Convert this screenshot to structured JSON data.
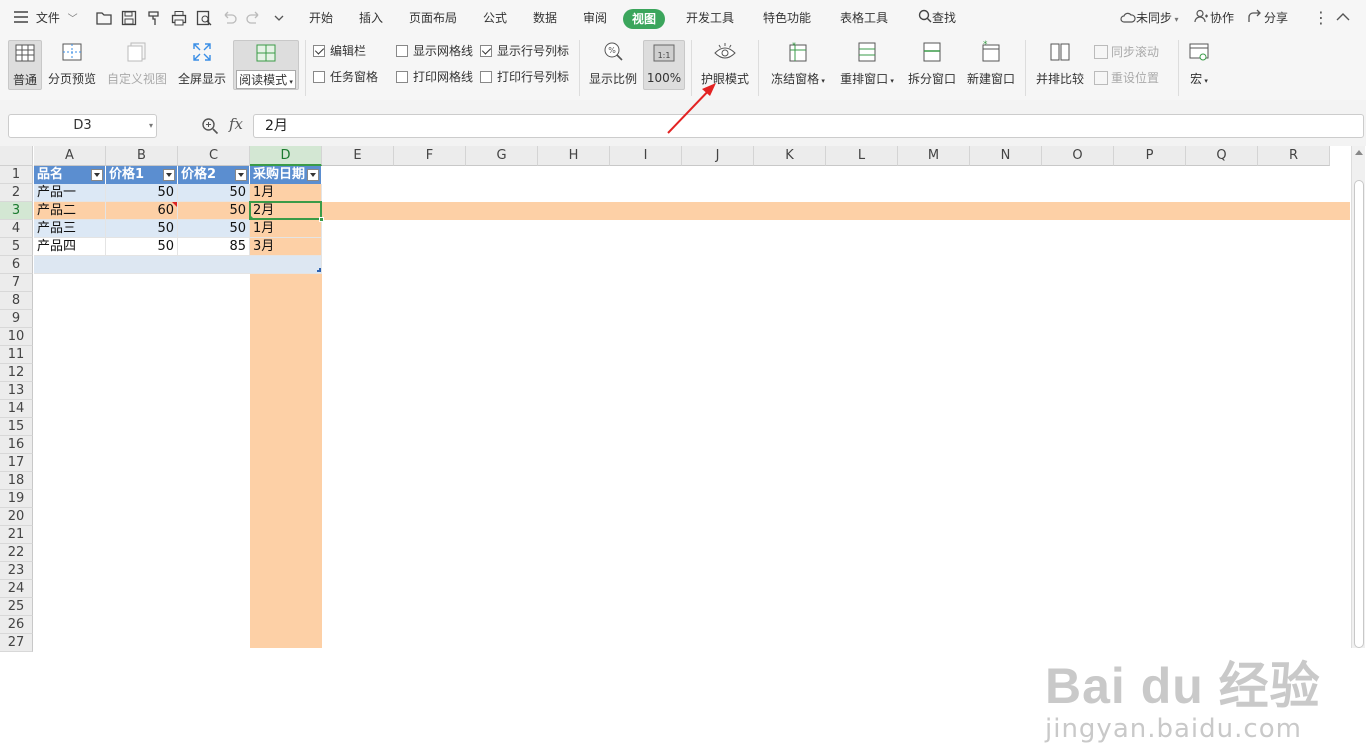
{
  "menubar": {
    "file_label": "文件",
    "tabs": [
      "开始",
      "插入",
      "页面布局",
      "公式",
      "数据",
      "审阅",
      "视图",
      "开发工具",
      "特色功能",
      "表格工具"
    ],
    "active_tab": "视图",
    "search_label": "查找",
    "sync_label": "未同步",
    "collab_label": "协作",
    "share_label": "分享"
  },
  "ribbon": {
    "normal": "普通",
    "page_preview": "分页预览",
    "custom_view": "自定义视图",
    "fullscreen": "全屏显示",
    "reading_mode": "阅读模式",
    "checkboxes": {
      "edit_bar": {
        "label": "编辑栏",
        "checked": true
      },
      "task_pane": {
        "label": "任务窗格",
        "checked": false
      },
      "show_grid": {
        "label": "显示网格线",
        "checked": false
      },
      "show_headers": {
        "label": "显示行号列标",
        "checked": true
      },
      "print_grid": {
        "label": "打印网格线",
        "checked": false
      },
      "print_headers": {
        "label": "打印行号列标",
        "checked": false
      }
    },
    "zoom_ratio": "显示比例",
    "zoom_100": "100%",
    "zoom_100_icon": "1:1",
    "eye_protect": "护眼模式",
    "freeze": "冻结窗格",
    "rearrange": "重排窗口",
    "split": "拆分窗口",
    "new_window": "新建窗口",
    "side_by_side": "并排比较",
    "sync_scroll": "同步滚动",
    "reset_position": "重设位置",
    "macro": "宏"
  },
  "formula_bar": {
    "name_box": "D3",
    "fx_label": "fx",
    "content": "2月"
  },
  "grid": {
    "columns": [
      "A",
      "B",
      "C",
      "D",
      "E",
      "F",
      "G",
      "H",
      "I",
      "J",
      "K",
      "L",
      "M",
      "N",
      "O",
      "P",
      "Q",
      "R"
    ],
    "selected_column": "D",
    "row_numbers": [
      "1",
      "2",
      "3",
      "4",
      "5",
      "6",
      "7",
      "8",
      "9",
      "10",
      "11",
      "12",
      "13",
      "14",
      "15",
      "16",
      "17",
      "18",
      "19",
      "20",
      "21",
      "22",
      "23",
      "24",
      "25",
      "26",
      "27"
    ],
    "selected_row": "3",
    "table_headers": [
      "品名",
      "价格1",
      "价格2",
      "采购日期"
    ],
    "table_rows": [
      [
        "产品一",
        "50",
        "50",
        "1月"
      ],
      [
        "产品二",
        "60",
        "50",
        "2月"
      ],
      [
        "产品三",
        "50",
        "50",
        "1月"
      ],
      [
        "产品四",
        "50",
        "85",
        "3月"
      ]
    ],
    "highlight_color": "#fdd0a6",
    "header_color": "#5b8ed0",
    "band_color": "#dce8f5"
  },
  "watermark": {
    "main": "Bai du 经验",
    "sub": "jingyan.baidu.com"
  }
}
